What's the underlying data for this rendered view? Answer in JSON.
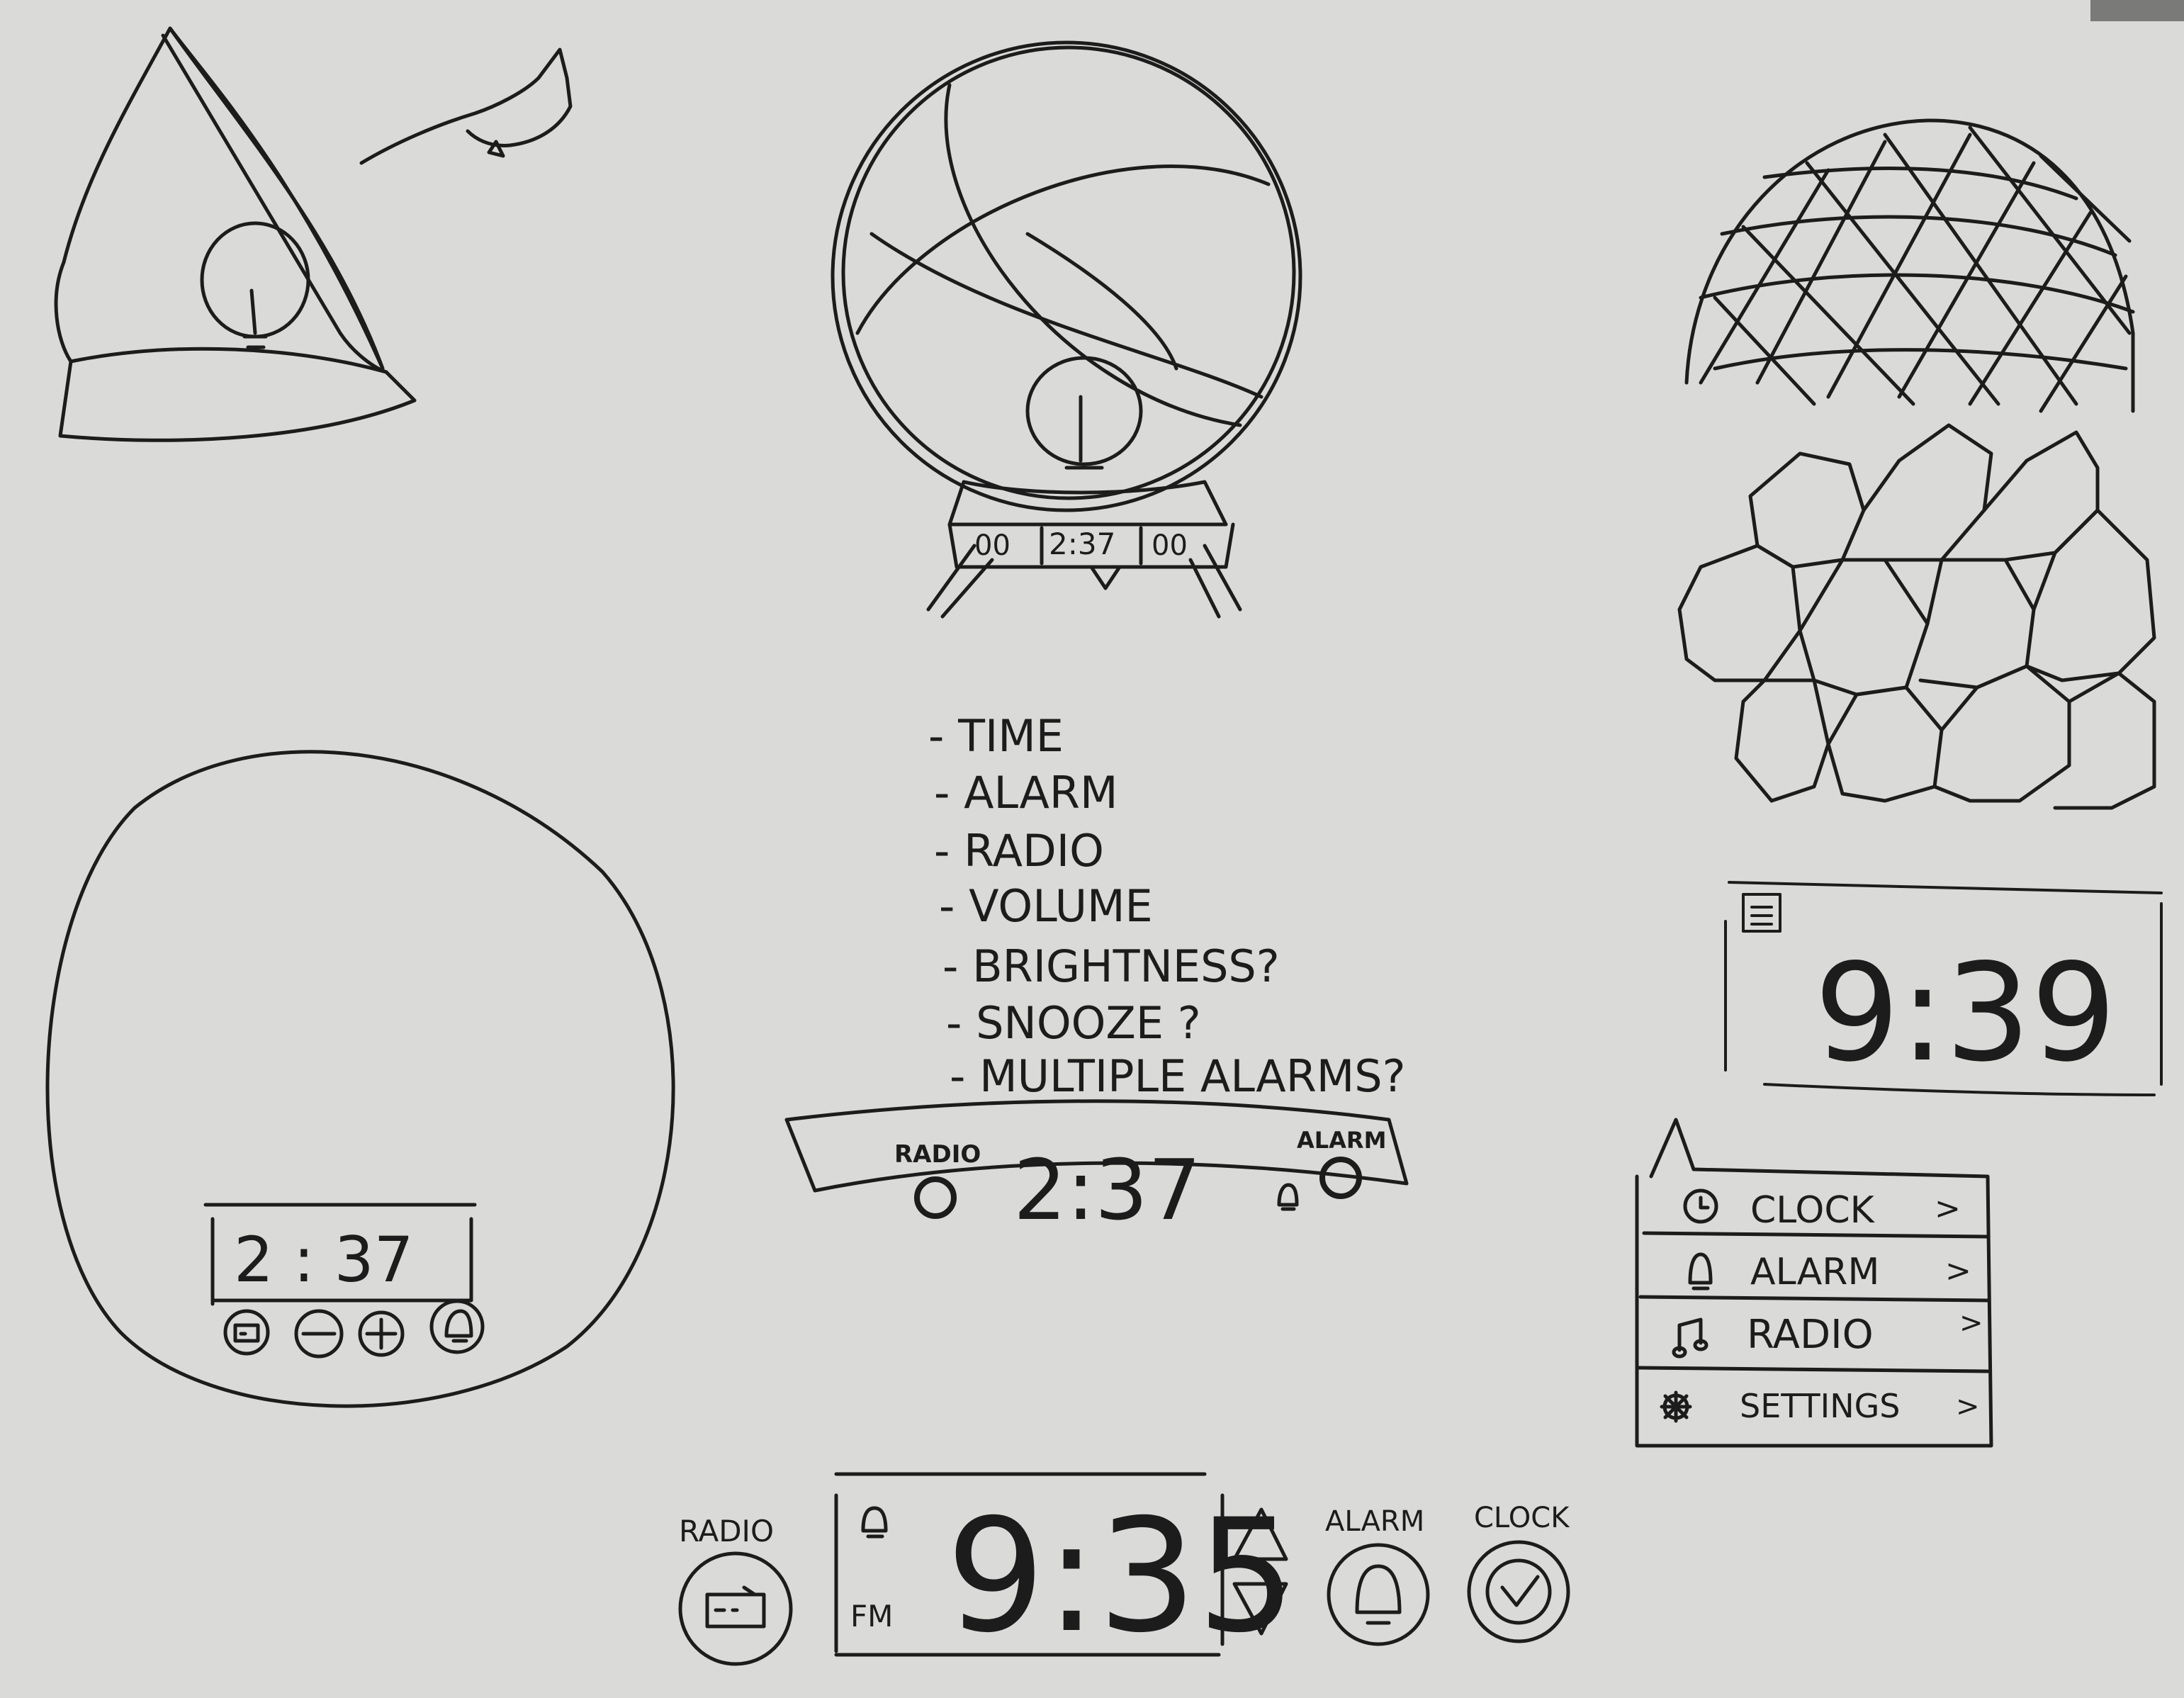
{
  "notes": {
    "features": [
      "- TIME",
      "- ALARM",
      "- RADIO",
      "- VOLUME",
      "- BRIGHTNESS?",
      "- SNOOZE ?",
      "- MULTIPLE ALARMS?"
    ]
  },
  "globe_sketch": {
    "display_left": "00",
    "display_time": "2:37",
    "display_right": "00"
  },
  "round_sketch": {
    "display_time": "2 : 37"
  },
  "band_sketch": {
    "radio_label": "RADIO",
    "alarm_label": "ALARM",
    "time": "2:37"
  },
  "small_display": {
    "time": "9:39"
  },
  "menu": {
    "items": [
      {
        "label": "CLOCK",
        "icon": "clock-icon",
        "chevron": ">"
      },
      {
        "label": "ALARM",
        "icon": "bell-icon",
        "chevron": ">"
      },
      {
        "label": "RADIO",
        "icon": "music-note-icon",
        "chevron": ">"
      },
      {
        "label": "SETTINGS",
        "icon": "gear-icon",
        "chevron": ">"
      }
    ]
  },
  "bottom_bar": {
    "radio_label": "RADIO",
    "band_label": "FM",
    "time": "9:35",
    "alarm_label": "ALARM",
    "clock_label": "CLOCK"
  },
  "colors": {
    "paper": "#d9d9d7",
    "ink": "#1c1c1c"
  }
}
